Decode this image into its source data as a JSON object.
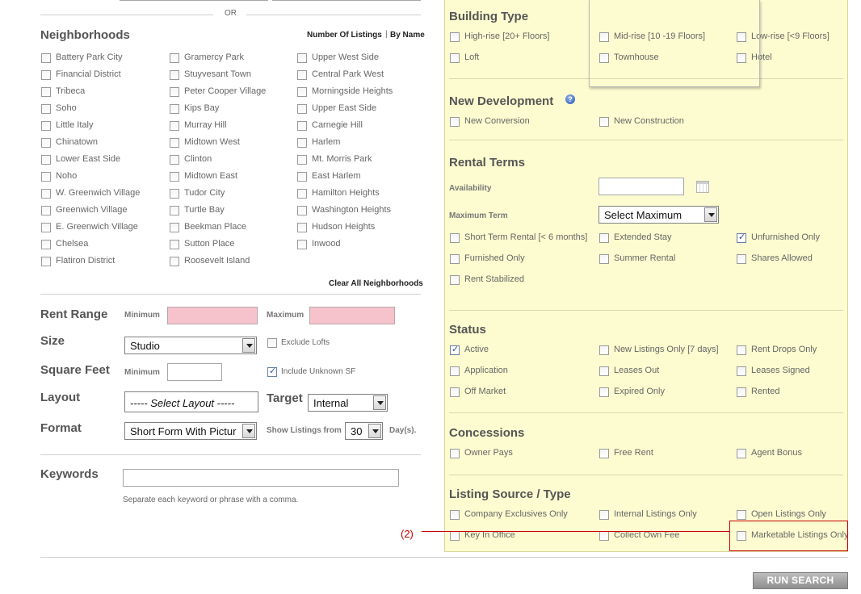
{
  "or_label": "OR",
  "neighborhoods": {
    "title": "Neighborhoods",
    "sort_label": "Number Of Listings",
    "sort_sep": "|",
    "sort_by_name": "By Name",
    "clear_all": "Clear All Neighborhoods",
    "col1": [
      "Battery Park City",
      "Financial District",
      "Tribeca",
      "Soho",
      "Little Italy",
      "Chinatown",
      "Lower East Side",
      "Noho",
      "W. Greenwich Village",
      "Greenwich Village",
      "E. Greenwich Village",
      "Chelsea",
      "Flatiron District"
    ],
    "col2": [
      "Gramercy Park",
      "Stuyvesant Town",
      "Peter Cooper Village",
      "Kips Bay",
      "Murray Hill",
      "Midtown West",
      "Clinton",
      "Midtown East",
      "Tudor City",
      "Turtle Bay",
      "Beekman Place",
      "Sutton Place",
      "Roosevelt Island"
    ],
    "col3": [
      "Upper West Side",
      "Central Park West",
      "Morningside Heights",
      "Upper East Side",
      "Carnegie Hill",
      "Harlem",
      "Mt. Morris Park",
      "East Harlem",
      "Hamilton Heights",
      "Washington Heights",
      "Hudson Heights",
      "Inwood"
    ]
  },
  "filters": {
    "rent_range": "Rent Range",
    "minimum": "Minimum",
    "maximum": "Maximum",
    "size": "Size",
    "size_value": "Studio",
    "exclude_lofts": "Exclude Lofts",
    "square_feet": "Square Feet",
    "sf_minimum": "Minimum",
    "include_unknown_sf": "Include Unknown SF",
    "layout": "Layout",
    "layout_placeholder": "----- Select Layout -----",
    "target": "Target",
    "target_value": "Internal",
    "format": "Format",
    "format_value": "Short Form With Pictur",
    "show_listings_from": "Show Listings from",
    "days_value": "30",
    "days_unit": "Day(s).",
    "keywords": "Keywords",
    "keywords_hint": "Separate each keyword or phrase with a comma."
  },
  "building_type": {
    "title": "Building Type",
    "items": [
      "High-rise [20+ Floors]",
      "Mid-rise [10 -19 Floors]",
      "Low-rise [<9 Floors]",
      "Loft",
      "Townhouse",
      "Hotel"
    ]
  },
  "new_development": {
    "title": "New Development",
    "help_icon": "?",
    "items": [
      "New Conversion",
      "New Construction"
    ]
  },
  "rental_terms": {
    "title": "Rental Terms",
    "availability": "Availability",
    "maximum_term": "Maximum Term",
    "maximum_value": "Select Maximum",
    "items": [
      "Short Term Rental [< 6 months]",
      "Extended Stay",
      "Unfurnished Only",
      "Furnished Only",
      "Summer Rental",
      "Shares Allowed",
      "Rent Stabilized"
    ]
  },
  "status": {
    "title": "Status",
    "items": [
      "Active",
      "New Listings Only [7 days]",
      "Rent Drops Only",
      "Application",
      "Leases Out",
      "Leases Signed",
      "Off Market",
      "Expired Only",
      "Rented"
    ]
  },
  "concessions": {
    "title": "Concessions",
    "items": [
      "Owner Pays",
      "Free Rent",
      "Agent Bonus"
    ]
  },
  "listing_source": {
    "title": "Listing Source / Type",
    "items": [
      "Company Exclusives Only",
      "Internal Listings Only",
      "Open Listings Only",
      "Key In Office",
      "Collect Own Fee",
      "Marketable Listings Only"
    ]
  },
  "annotation": "(2)",
  "run_search": "RUN SEARCH",
  "colors": {
    "panel": "#fdfcd0",
    "annotation": "#cc0000",
    "pink_input": "#f6c3cc"
  }
}
